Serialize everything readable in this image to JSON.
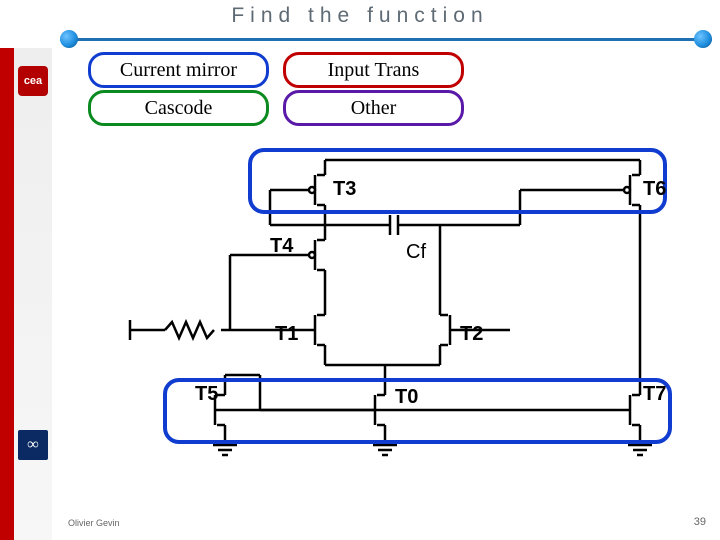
{
  "title": "Find the function",
  "legend": {
    "current_mirror": "Current mirror",
    "input_trans": "Input Trans",
    "cascode": "Cascode",
    "other": "Other"
  },
  "colors": {
    "current_mirror": "#103dcf",
    "input_trans": "#c00000",
    "cascode": "#0a8a1f",
    "other": "#5a1aa8",
    "accent_blue": "#1f8fe0",
    "sidebar_red": "#c00000"
  },
  "schematic": {
    "labels": {
      "T0": "T0",
      "T1": "T1",
      "T2": "T2",
      "T3": "T3",
      "T4": "T4",
      "T5": "T5",
      "T6": "T6",
      "T7": "T7",
      "Cf": "Cf"
    },
    "highlight_groups": {
      "top_current_mirror": [
        "T3",
        "T6"
      ],
      "bottom_current_mirror": [
        "T5",
        "T0",
        "T7"
      ]
    }
  },
  "logos": {
    "cea": "cea",
    "irfu": "∞"
  },
  "footer": {
    "author": "Olivier Gevin",
    "page": "39"
  }
}
